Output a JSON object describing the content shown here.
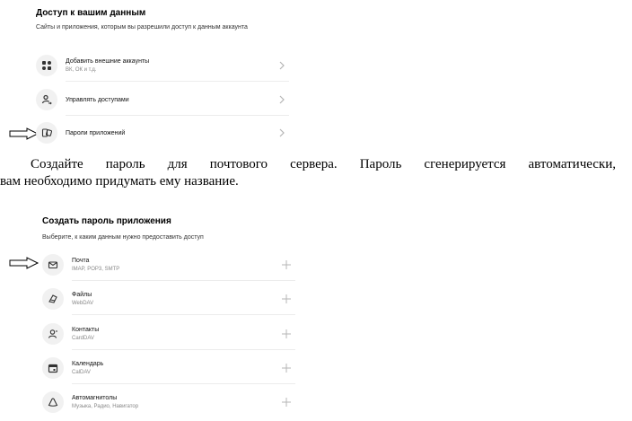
{
  "access": {
    "title": "Доступ к вашим данным",
    "subtitle": "Сайты и приложения, которым вы разрешили доступ к данным аккаунта",
    "items": [
      {
        "label": "Добавить внешние аккаунты",
        "sub": "ВК, ОК и т.д."
      },
      {
        "label": "Управлять доступами",
        "sub": ""
      },
      {
        "label": "Пароли приложений",
        "sub": ""
      }
    ]
  },
  "instruction": {
    "line1": "Создайте пароль для почтового сервера. Пароль сгенерируется автоматически,",
    "line2": "вам необходимо придумать ему название."
  },
  "create": {
    "title": "Создать пароль приложения",
    "subtitle": "Выберите, к каким данным нужно предоставить доступ",
    "items": [
      {
        "label": "Почта",
        "sub": "IMAP, POP3, SMTP"
      },
      {
        "label": "Файлы",
        "sub": "WebDAV"
      },
      {
        "label": "Контакты",
        "sub": "CardDAV"
      },
      {
        "label": "Календарь",
        "sub": "CalDAV"
      },
      {
        "label": "Автомагнитолы",
        "sub": "Музыка, Радио, Навигатор"
      }
    ]
  },
  "colors": {
    "icon_bg": "#f1f1f1",
    "separator": "#ececec",
    "chevron": "#b5b5b5",
    "secondary_text": "#888888"
  },
  "icons": [
    "grid-accounts-icon",
    "person-arrow-icon",
    "app-passwords-icon",
    "mail-icon",
    "files-icon",
    "contacts-icon",
    "calendar-icon",
    "car-icon",
    "pointer-arrow-icon"
  ]
}
